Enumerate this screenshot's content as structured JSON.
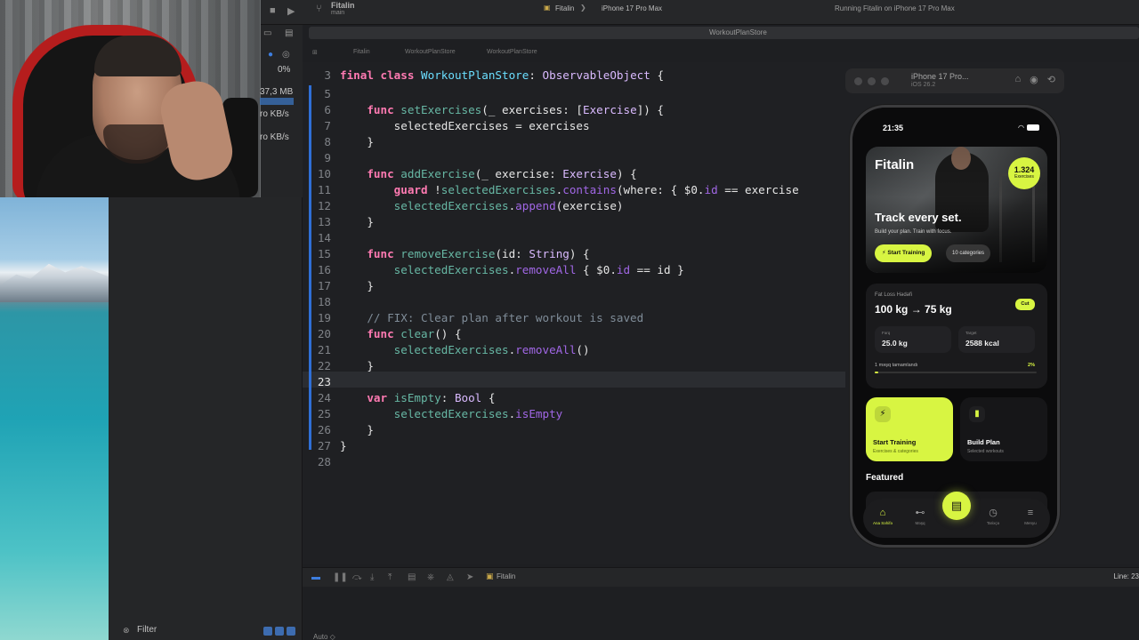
{
  "toolbar": {
    "project_name": "Fitalin",
    "branch": "main",
    "scheme": "Fitalin",
    "device": "iPhone 17 Pro Max",
    "status": "Running Fitalin on iPhone 17 Pro Max",
    "open_tab": "WorkoutPlanStore",
    "breadcrumb": [
      "Fitalin",
      "WorkoutPlanStore",
      "WorkoutPlanStore"
    ]
  },
  "debug_gauges": {
    "cpu": "0%",
    "memory": "37,3 MB",
    "disk": "ro KB/s",
    "network": "ro KB/s"
  },
  "filter_label": "Filter",
  "debug_bar": {
    "target": "Fitalin",
    "line_info": "Line: 23"
  },
  "bottom": {
    "auto_label": "Auto ◇"
  },
  "editor": {
    "sticky_line": {
      "n": "3",
      "tokens": [
        {
          "t": "final",
          "c": "kw"
        },
        {
          "t": " "
        },
        {
          "t": "class",
          "c": "kw"
        },
        {
          "t": " "
        },
        {
          "t": "WorkoutPlanStore",
          "c": "ty"
        },
        {
          "t": ": "
        },
        {
          "t": "ObservableObject",
          "c": "tyb"
        },
        {
          "t": " {"
        }
      ]
    },
    "lines": [
      {
        "n": "5",
        "tokens": []
      },
      {
        "n": "6",
        "tokens": [
          {
            "t": "    "
          },
          {
            "t": "func",
            "c": "kw"
          },
          {
            "t": " "
          },
          {
            "t": "setExercises",
            "c": "fn"
          },
          {
            "t": "(_ exercises: ["
          },
          {
            "t": "Exercise",
            "c": "tyb"
          },
          {
            "t": "]) {"
          }
        ]
      },
      {
        "n": "7",
        "tokens": [
          {
            "t": "        selectedExercises = exercises"
          }
        ]
      },
      {
        "n": "8",
        "tokens": [
          {
            "t": "    }"
          }
        ]
      },
      {
        "n": "9",
        "tokens": []
      },
      {
        "n": "10",
        "tokens": [
          {
            "t": "    "
          },
          {
            "t": "func",
            "c": "kw"
          },
          {
            "t": " "
          },
          {
            "t": "addExercise",
            "c": "fn"
          },
          {
            "t": "(_ exercise: "
          },
          {
            "t": "Exercise",
            "c": "tyb"
          },
          {
            "t": ") {"
          }
        ]
      },
      {
        "n": "11",
        "tokens": [
          {
            "t": "        "
          },
          {
            "t": "guard",
            "c": "kw"
          },
          {
            "t": " !"
          },
          {
            "t": "selectedExercises",
            "c": "fn"
          },
          {
            "t": "."
          },
          {
            "t": "contains",
            "c": "mb"
          },
          {
            "t": "(where: { $0."
          },
          {
            "t": "id",
            "c": "mb"
          },
          {
            "t": " == exercise"
          }
        ]
      },
      {
        "n": "12",
        "tokens": [
          {
            "t": "        "
          },
          {
            "t": "selectedExercises",
            "c": "fn"
          },
          {
            "t": "."
          },
          {
            "t": "append",
            "c": "mb"
          },
          {
            "t": "(exercise)"
          }
        ]
      },
      {
        "n": "13",
        "tokens": [
          {
            "t": "    }"
          }
        ]
      },
      {
        "n": "14",
        "tokens": []
      },
      {
        "n": "15",
        "tokens": [
          {
            "t": "    "
          },
          {
            "t": "func",
            "c": "kw"
          },
          {
            "t": " "
          },
          {
            "t": "removeExercise",
            "c": "fn"
          },
          {
            "t": "(id: "
          },
          {
            "t": "String",
            "c": "tyb"
          },
          {
            "t": ") {"
          }
        ]
      },
      {
        "n": "16",
        "tokens": [
          {
            "t": "        "
          },
          {
            "t": "selectedExercises",
            "c": "fn"
          },
          {
            "t": "."
          },
          {
            "t": "removeAll",
            "c": "mb"
          },
          {
            "t": " { $0."
          },
          {
            "t": "id",
            "c": "mb"
          },
          {
            "t": " == id }"
          }
        ]
      },
      {
        "n": "17",
        "tokens": [
          {
            "t": "    }"
          }
        ]
      },
      {
        "n": "18",
        "tokens": []
      },
      {
        "n": "19",
        "tokens": [
          {
            "t": "    "
          },
          {
            "t": "// FIX: Clear plan after workout is saved",
            "c": "cm"
          }
        ]
      },
      {
        "n": "20",
        "tokens": [
          {
            "t": "    "
          },
          {
            "t": "func",
            "c": "kw"
          },
          {
            "t": " "
          },
          {
            "t": "clear",
            "c": "fn"
          },
          {
            "t": "() {"
          }
        ]
      },
      {
        "n": "21",
        "tokens": [
          {
            "t": "        "
          },
          {
            "t": "selectedExercises",
            "c": "fn"
          },
          {
            "t": "."
          },
          {
            "t": "removeAll",
            "c": "mb"
          },
          {
            "t": "()"
          }
        ]
      },
      {
        "n": "22",
        "tokens": [
          {
            "t": "    }"
          }
        ]
      },
      {
        "n": "23",
        "tokens": [],
        "active": true
      },
      {
        "n": "24",
        "tokens": [
          {
            "t": "    "
          },
          {
            "t": "var",
            "c": "kw"
          },
          {
            "t": " "
          },
          {
            "t": "isEmpty",
            "c": "fn"
          },
          {
            "t": ": "
          },
          {
            "t": "Bool",
            "c": "tyb"
          },
          {
            "t": " {"
          }
        ]
      },
      {
        "n": "25",
        "tokens": [
          {
            "t": "        "
          },
          {
            "t": "selectedExercises",
            "c": "fn"
          },
          {
            "t": "."
          },
          {
            "t": "isEmpty",
            "c": "mb"
          }
        ]
      },
      {
        "n": "26",
        "tokens": [
          {
            "t": "    }"
          }
        ]
      },
      {
        "n": "27",
        "tokens": [
          {
            "t": "}"
          }
        ]
      },
      {
        "n": "28",
        "tokens": []
      }
    ]
  },
  "simulator": {
    "device_name": "iPhone 17 Pro...",
    "os_version": "iOS 26.2",
    "status_time": "21:35"
  },
  "app": {
    "brand": "Fitalin",
    "exercise_count": "1.324",
    "exercise_count_label": "Exercises",
    "hero_title": "Track every set.",
    "hero_subtitle": "Build your plan. Train with focus.",
    "hero_button": "Start Training",
    "hero_pill": "10 categories",
    "goal": {
      "label": "Fat Loss Hədəfi",
      "value": "100 kg → 75 kg",
      "chip": "Cut",
      "diff_label": "Fərq",
      "diff_value": "25.0 kg",
      "target_label": "Target",
      "target_value": "2588 kcal",
      "progress_label": "1 məşq tamamlandı",
      "progress_text": "2%",
      "progress": 0.02
    },
    "tiles": [
      {
        "title": "Start Training",
        "subtitle": "Exercises & categories",
        "icon": "bolt-icon"
      },
      {
        "title": "Build Plan",
        "subtitle": "Selected workouts",
        "icon": "clipboard-icon"
      }
    ],
    "featured_label": "Featured",
    "tabs": [
      {
        "label": "Ana Səhifə",
        "icon": "home-icon"
      },
      {
        "label": "Məşq",
        "icon": "dumbbell-icon"
      },
      {
        "label": "Tarixçə",
        "icon": "history-icon"
      },
      {
        "label": "Menyu",
        "icon": "menu-icon"
      }
    ]
  },
  "colors": {
    "accent": "#d8f542",
    "editor_bg": "#1f2023",
    "keyword": "#ff7ab2",
    "type": "#6bdfff"
  }
}
